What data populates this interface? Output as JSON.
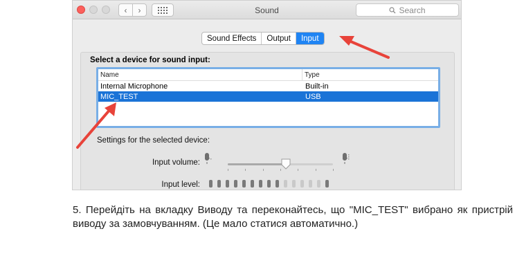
{
  "window": {
    "title": "Sound",
    "search_placeholder": "Search",
    "nav_back": "‹",
    "nav_forward": "›"
  },
  "tabs": [
    {
      "label": "Sound Effects",
      "active": false
    },
    {
      "label": "Output",
      "active": false
    },
    {
      "label": "Input",
      "active": true
    }
  ],
  "input": {
    "section_title": "Select a device for sound input:",
    "columns": [
      "Name",
      "Type"
    ],
    "devices": [
      {
        "name": "Internal Microphone",
        "type": "Built-in",
        "selected": false
      },
      {
        "name": "MIC_TEST",
        "type": "USB",
        "selected": true
      }
    ],
    "settings_title": "Settings for the selected device:",
    "volume_label": "Input volume:",
    "level_label": "Input level:",
    "volume_level": 0.55,
    "level_segments_total": 15,
    "level_segments_lit": 9
  },
  "caption": {
    "text": "5. Перейдіть на вкладку Виводу та переконайтесь, що \"MIC_TEST\" вибрано як пристрій виводу за замовчуванням. (Це мало статися автоматично.)"
  },
  "colors": {
    "accent": "#1f84f3",
    "selection": "#1a73d7",
    "arrow": "#e8433a"
  },
  "icons": [
    "search-icon",
    "grid-icon",
    "microphone-icon",
    "annotation-arrow"
  ]
}
